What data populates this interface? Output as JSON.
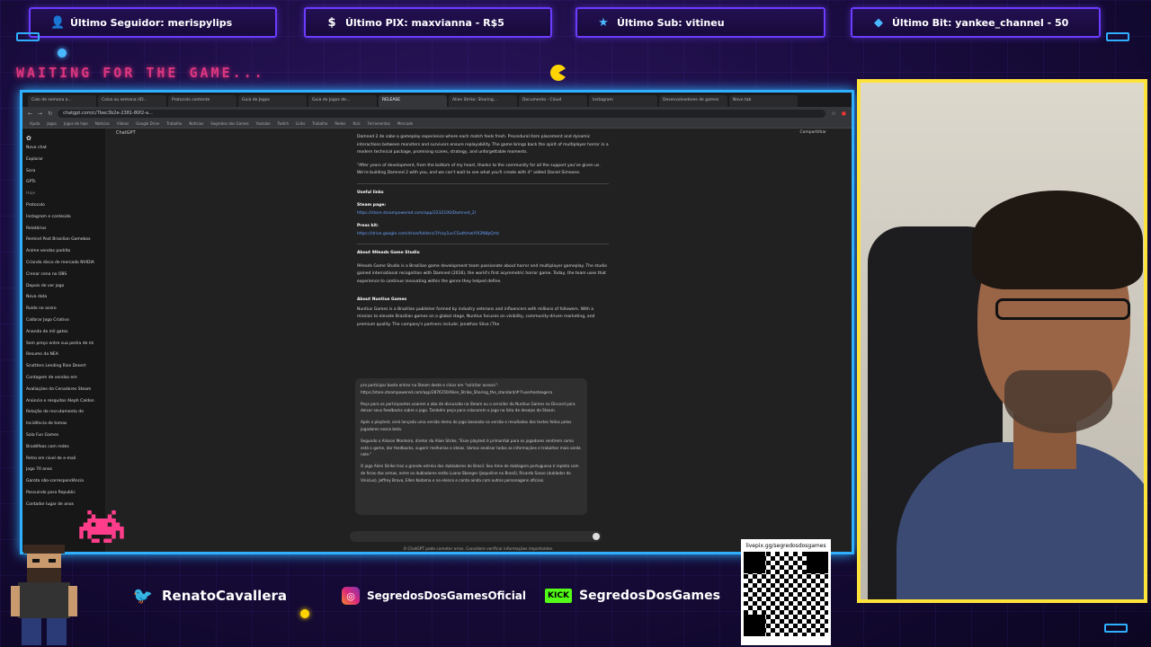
{
  "overlay": {
    "last_follower": "Último Seguidor: merispylips",
    "last_pix": "Último PIX: maxvianna - R$5",
    "last_sub": "Último Sub: vitineu",
    "last_bit": "Último Bit: yankee_channel - 50",
    "waiting_text": "WAITING FOR THE GAME...",
    "twitter_handle": "RenatoCavallera",
    "instagram_handle": "SegredosDosGamesOficial",
    "kick_logo": "KICK",
    "kick_handle": "SegredosDosGames",
    "livepix_url": "livepix.gg/segredosdosgames",
    "colors": {
      "frame": "#2fb0ff",
      "webcam_border": "#ffe23a",
      "purple": "#6c3cff"
    }
  },
  "browser": {
    "tabs": [
      "Calo de semana a...",
      "Coisa ou semana (ID...",
      "Protocolo contente",
      "Guia de Jogos",
      "Guia de Jogos de...",
      "RELEASE",
      "Alien Strike: Sharing...",
      "Documento - Cloud",
      "Instagram",
      "Desenvolvedores de games",
      "Novo tab"
    ],
    "url": "chatgpt.com/c/7bec3b2e-2381-80f2-a...",
    "bookmarks": [
      "Ajuda",
      "Jogos",
      "Jogos de hoje",
      "Notícias",
      "Vídeos",
      "Google Drive",
      "Trabalho",
      "Notícias",
      "Segredos dos Games",
      "Youtube",
      "Twitch",
      "Links",
      "Trabalho",
      "Redes",
      "Kick",
      "Ferramentas",
      "Mercado"
    ]
  },
  "chatgpt": {
    "app_title": "ChatGPT",
    "share_label": "Compartilhar",
    "sidebar": {
      "items": [
        "Nova chat",
        "Explorar",
        "Sora",
        "GPTs",
        "Hoje",
        "Protocolo",
        "Instagram e conteúdo",
        "Relatórios",
        "Remind Post Brasilian Gamebox",
        "Anime vendas padrão",
        "Criando disco de mercado NVIDIA",
        "Crenar cena no OBS",
        "Depois de ver jogo",
        "Nova data",
        "Ruído no acero",
        "Calibrar Jogo Criativo",
        "Ananda de mil gatos",
        "Sem preço entre sua pedra de mi",
        "Resumo da NEA",
        "Scuttlers Lending Rise Desert",
        "Contagem de vendas em",
        "Avaliações da Cenadores Steam",
        "Anúncio e resquitos Aleph Caldon",
        "Relação de recrutamento de",
        "Incidência de tomas",
        "Sala Fun Games",
        "Bradéfeas com redes",
        "Retro em nível de e-mail",
        "Jogo 70 anos",
        "Garota não-correspondência",
        "Possuindo para Republic",
        "Contador lugar de anos"
      ]
    },
    "content": {
      "p1": "Damned 2 de sabe a gameplay experience where each match feels fresh. Procedural item placement and dynamic interactions between monsters and survivors ensure replayability. The game brings back the spirit of multiplayer horror in a modern technical package, promising scares, strategy, and unforgettable moments.",
      "p2": "\"After years of development, from the bottom of my heart, thanks to the community for all the support you've given us. We're building Damned 2 with you, and we can't wait to see what you'll create with it\" added Daniel Simeone.",
      "useful_links_heading": "Useful links",
      "steam_label": "Steam page:",
      "steam_url": "https://store.steampowered.com/app/2232100/Damned_2/",
      "presskit_label": "Press kit:",
      "presskit_url": "https://drive.google.com/drive/folders/1Yszy1ucCSuthmwYlX2N8pQrtz",
      "about_studio_heading": "About 9Heads Game Studio",
      "about_studio_text": "9Heads Game Studio is a Brazilian game development team passionate about horror and multiplayer gameplay. The studio gained international recognition with Damned (2016), the world's first asymmetric horror game. Today, the team uses that experience to continue innovating within the genre they helped define.",
      "about_nuntius_heading": "About Nuntius Games",
      "about_nuntius_text": "Nuntius Games is a Brazilian publisher formed by industry veterans and influencers with millions of followers. With a mission to elevate Brazilian games on a global stage, Nuntius focuses on visibility, community-driven marketing, and premium quality. The company's partners include: Jonathan Silva (The"
    },
    "quote": {
      "p0": "pra participar basta entrar na Steam deste e clicar em \"solicitar acesso\":",
      "p0_url": "https://store.steampowered.com/app/2876150/Alien_Strike_Sharing_the_standard/#!?userhosteagera",
      "p1": "Peça para os participantes usarem a aba de discussão na Steam ou o servidor da Nuntius Games no Discord para deixar seus feedbacks sobre o jogo. Também peça para colocarem o jogo na lista de desejos da Steam.",
      "p2": "Após o playtest, será lançada uma versão demo do jogo baseada na versão e resultados dos testes feitos pelos jogadores nessa beta.",
      "p3": "Segundo o Alisson Monteiro, diretor da Alien Strike, \"Esse playtest é primordial para os jogadores sentirem como está o game, dar feedbacks, sugerir melhorias e ideias. Vamos analisar todas as informações e trabalhar mais ainda nele.\"",
      "p4": "O jogo Alien Strike traz a grande estreia dos dubladores do Brasil. Seu time de dublagem portuguesa é repleta com de feras das armas, entre os dubladores estão Luana Sbanger (Jaqueline no Brasil), Ricardo Sasso (dublador do Vinícius), Jeffrey Bravo, Ellen Kodama e no elenco e conta ainda com outros personagens oficiais."
    },
    "disclaimer": "O ChatGPT pode cometer erros. Considere verificar informações importantes."
  }
}
